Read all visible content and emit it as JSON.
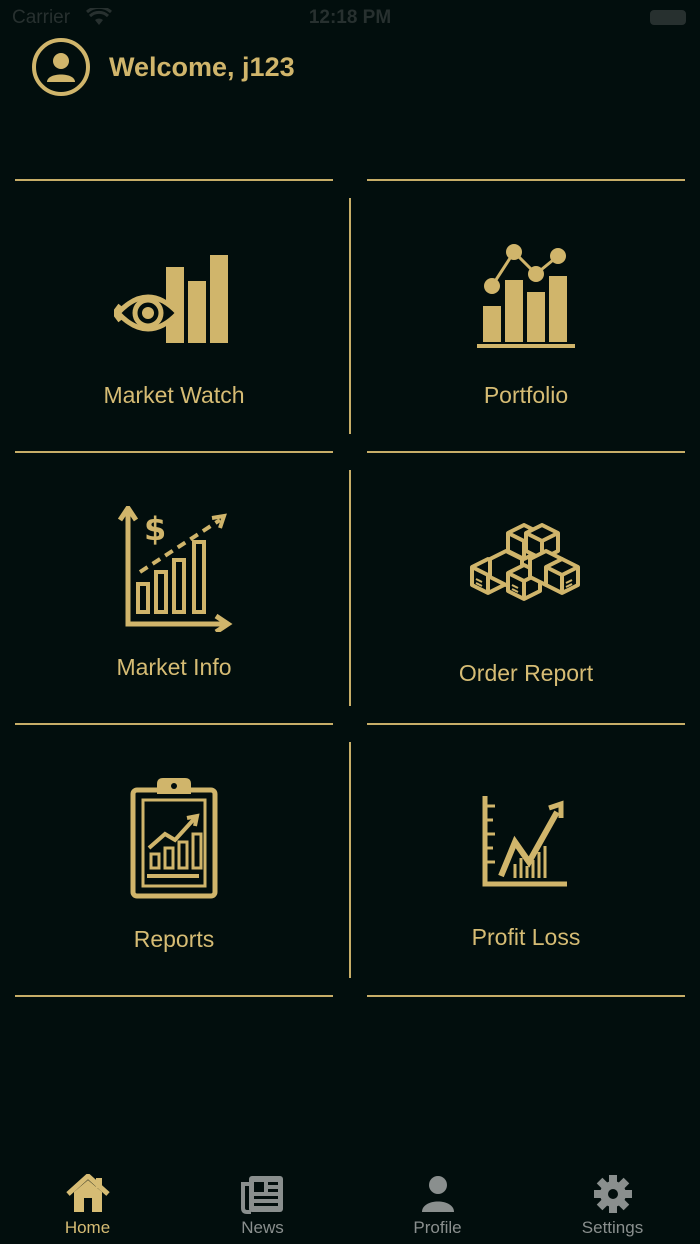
{
  "status_bar": {
    "carrier": "Carrier",
    "time": "12:18 PM"
  },
  "header": {
    "welcome": "Welcome, j123"
  },
  "tiles": [
    {
      "label": "Market Watch",
      "icon": "eye-chart-icon"
    },
    {
      "label": "Portfolio",
      "icon": "bar-line-chart-icon"
    },
    {
      "label": "Market Info",
      "icon": "dollar-growth-chart-icon"
    },
    {
      "label": "Order Report",
      "icon": "boxes-icon"
    },
    {
      "label": "Reports",
      "icon": "clipboard-chart-icon"
    },
    {
      "label": "Profit Loss",
      "icon": "profit-loss-chart-icon"
    }
  ],
  "tab_bar": {
    "active": "Home",
    "tabs": [
      {
        "label": "Home",
        "icon": "home-icon"
      },
      {
        "label": "News",
        "icon": "newspaper-icon"
      },
      {
        "label": "Profile",
        "icon": "person-icon"
      },
      {
        "label": "Settings",
        "icon": "gear-icon"
      }
    ]
  },
  "colors": {
    "background": "#020e0d",
    "accent": "#d0b56b",
    "inactive": "#8a8f8e"
  }
}
